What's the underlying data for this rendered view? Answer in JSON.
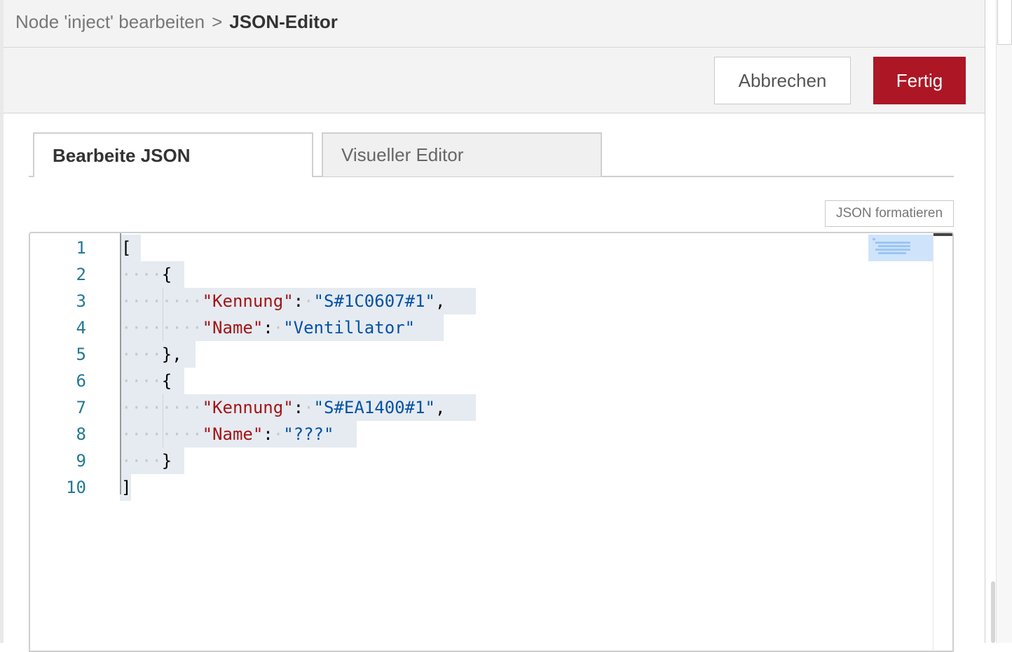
{
  "breadcrumb": {
    "parent": "Node 'inject' bearbeiten",
    "separator": ">",
    "current": "JSON-Editor"
  },
  "toolbar": {
    "cancel_label": "Abbrechen",
    "done_label": "Fertig"
  },
  "tabs": [
    {
      "label": "Bearbeite JSON",
      "active": true
    },
    {
      "label": "Visueller Editor",
      "active": false
    }
  ],
  "format_button": "JSON formatieren",
  "editor": {
    "line_numbers": [
      "1",
      "2",
      "3",
      "4",
      "5",
      "6",
      "7",
      "8",
      "9",
      "10"
    ],
    "lines": [
      {
        "indent": "",
        "punct": "["
      },
      {
        "indent": "····",
        "punct": "{"
      },
      {
        "indent": "········",
        "key": "\"Kennung\"",
        "sep": ":",
        "value": "\"S#1C0607#1\"",
        "trail": ","
      },
      {
        "indent": "········",
        "key": "\"Name\"",
        "sep": ":",
        "value": "\"Ventillator\"",
        "trail": ""
      },
      {
        "indent": "····",
        "punct": "},"
      },
      {
        "indent": "····",
        "punct": "{"
      },
      {
        "indent": "········",
        "key": "\"Kennung\"",
        "sep": ":",
        "value": "\"S#EA1400#1\"",
        "trail": ","
      },
      {
        "indent": "········",
        "key": "\"Name\"",
        "sep": ":",
        "value": "\"???\"",
        "trail": ""
      },
      {
        "indent": "····",
        "punct": "}"
      },
      {
        "indent": "",
        "punct": "]"
      }
    ]
  },
  "colors": {
    "accent": "#ad1625",
    "json_key": "#a31515",
    "json_string": "#0451a5",
    "line_number": "#237893",
    "selection": "#e5ebf1"
  }
}
